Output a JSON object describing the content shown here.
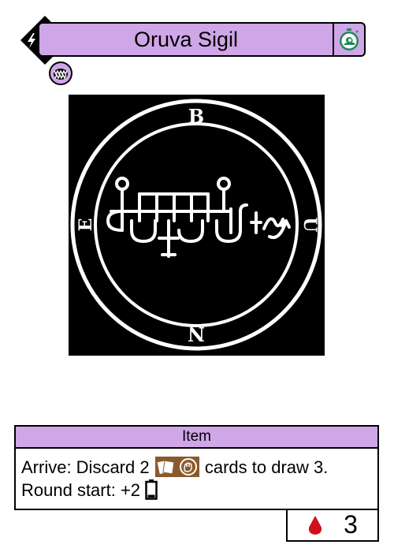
{
  "card": {
    "title": "Oruva Sigil",
    "cost": "3",
    "type": "Item",
    "ability": {
      "line1_before": "Arrive: Discard 2",
      "line1_after": "cards to draw 3.",
      "line2": "Round start: +2"
    },
    "life": "3"
  },
  "sigil": {
    "letters": {
      "top": "B",
      "right": "U",
      "bottom": "N",
      "left": "E"
    }
  },
  "icons": {
    "cost_icon": "lightning-icon",
    "speed_icon": "snail-stopwatch-icon",
    "faction_icon": "fanged-mouth-icon",
    "resource_icons": "cards-and-hand-icon",
    "energy_icon": "battery-icon",
    "life_icon": "blood-drop-icon"
  },
  "colors": {
    "accent": "#cfa6e8",
    "speed_green": "#1f8a5b",
    "life_red": "#d0101a",
    "resource_brown": "#8b5a2b"
  }
}
